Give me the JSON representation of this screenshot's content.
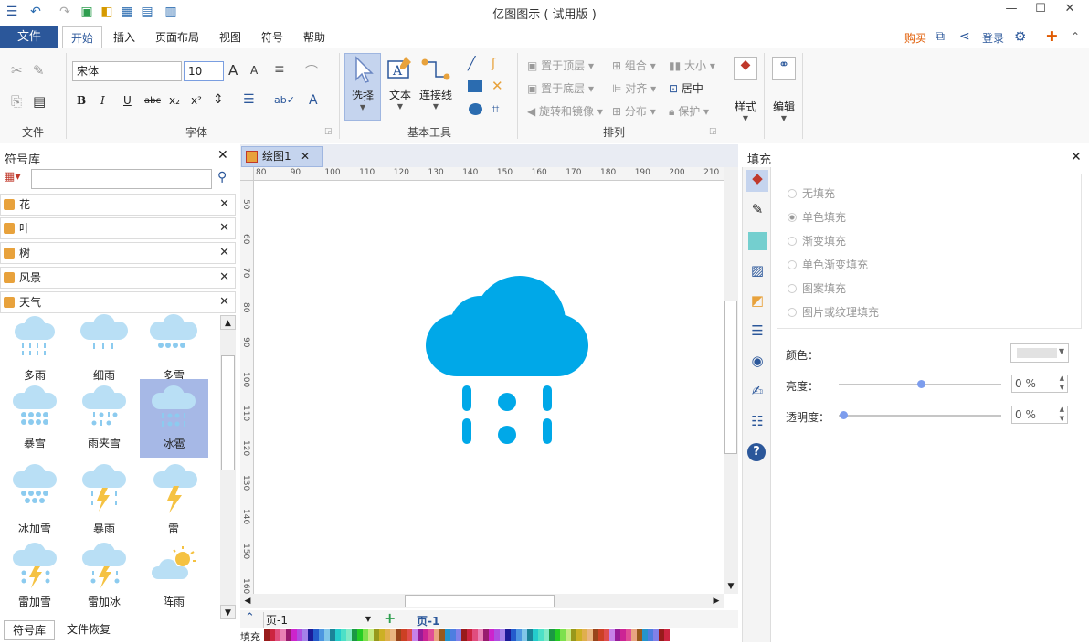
{
  "window": {
    "title": "亿图图示 ( 试用版 )"
  },
  "tabs": {
    "file": "文件",
    "items": [
      "开始",
      "插入",
      "页面布局",
      "视图",
      "符号",
      "帮助"
    ]
  },
  "topright": {
    "buy": "购买",
    "login": "登录"
  },
  "ribbon": {
    "font_name": "宋体",
    "font_size": "10",
    "groups": {
      "file": "文件",
      "font": "字体",
      "basic_tools": "基本工具",
      "arrange": "排列"
    },
    "tools": {
      "select": "选择",
      "text": "文本",
      "connector": "连接线",
      "style": "样式",
      "edit": "编辑"
    },
    "arrange": {
      "bring_front": "置于顶层",
      "send_back": "置于底层",
      "rotate": "旋转和镜像",
      "group": "组合",
      "align": "对齐",
      "distribute": "分布",
      "size": "大小",
      "center": "居中",
      "protect": "保护"
    }
  },
  "library": {
    "title": "符号库",
    "categories": [
      "花",
      "叶",
      "树",
      "风景",
      "天气"
    ],
    "symbols": [
      "多雨",
      "细雨",
      "多雪",
      "暴雪",
      "雨夹雪",
      "冰雹",
      "冰加雪",
      "暴雨",
      "雷",
      "雷加雪",
      "雷加冰",
      "阵雨"
    ],
    "bottom_tabs": [
      "符号库",
      "文件恢复"
    ]
  },
  "document": {
    "tab": "绘图1",
    "page_combo": "页-1",
    "page_tab": "页-1",
    "fill_label": "填充"
  },
  "ruler_h": [
    "80",
    "90",
    "100",
    "110",
    "120",
    "130",
    "140",
    "150",
    "160",
    "170",
    "180",
    "190",
    "200",
    "210"
  ],
  "ruler_v": [
    "50",
    "60",
    "70",
    "80",
    "90",
    "100",
    "110",
    "120",
    "130",
    "140",
    "150",
    "160"
  ],
  "fill_panel": {
    "title": "填充",
    "options": [
      "无填充",
      "单色填充",
      "渐变填充",
      "单色渐变填充",
      "图案填充",
      "图片或纹理填充"
    ],
    "selected": "单色填充",
    "color_label": "颜色：",
    "brightness_label": "亮度：",
    "brightness_value": "0 %",
    "transparency_label": "透明度：",
    "transparency_value": "0 %"
  },
  "colors": {
    "accent": "#2b579a",
    "icon_blue": "#00a8e8",
    "light_blue": "#b9dff5",
    "selected_bg": "#a6b8e6"
  }
}
